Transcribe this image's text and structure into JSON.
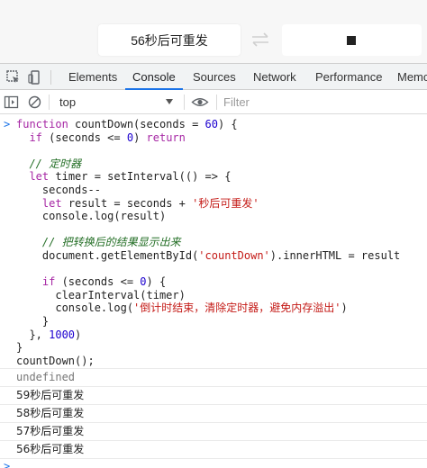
{
  "page": {
    "countdown_button_label": "56秒后可重发",
    "icons": {
      "arrows": "swap-arrows-icon",
      "stop": "stop-square-icon"
    }
  },
  "devtools": {
    "tabs": [
      "Elements",
      "Console",
      "Sources",
      "Network",
      "Performance",
      "Memo"
    ],
    "active_tab": "Console",
    "context_select": "top",
    "filter_placeholder": "Filter",
    "accent": "#1a73e8"
  },
  "console": {
    "code_lines": [
      "function countDown(seconds = 60) {",
      "  if (seconds <= 0) return",
      "",
      "  // 定时器",
      "  let timer = setInterval(() => {",
      "    seconds--",
      "    let result = seconds + '秒后可重发'",
      "    console.log(result)",
      "",
      "    // 把转换后的结果显示出来",
      "    document.getElementById('countDown').innerHTML = result",
      "",
      "    if (seconds <= 0) {",
      "      clearInterval(timer)",
      "      console.log('倒计时结束，清除定时器，避免内存溢出')",
      "    }",
      "  }, 1000)",
      "}",
      "countDown();"
    ],
    "return_value": "undefined",
    "log_outputs": [
      "59秒后可重发",
      "58秒后可重发",
      "57秒后可重发",
      "56秒后可重发"
    ]
  }
}
